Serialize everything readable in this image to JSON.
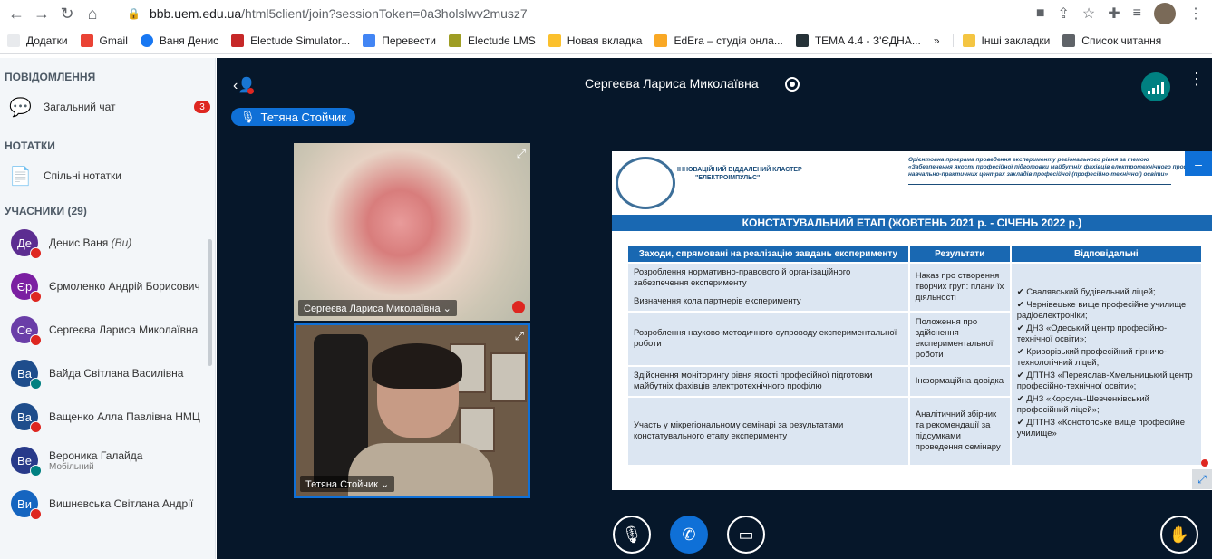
{
  "browser": {
    "url_host": "bbb.uem.edu.ua",
    "url_path": "/html5client/join?sessionToken=0a3holslwv2musz7"
  },
  "bookmarks": [
    {
      "label": "Додатки",
      "color": "#1a73e8"
    },
    {
      "label": "Gmail",
      "color": "#ea4335"
    },
    {
      "label": "Ваня Денис",
      "color": "#1877f2"
    },
    {
      "label": "Electude Simulator...",
      "color": "#c62828"
    },
    {
      "label": "Перевести",
      "color": "#4285f4"
    },
    {
      "label": "Electude LMS",
      "color": "#9e9d24"
    },
    {
      "label": "Новая вкладка",
      "color": "#fbc02d"
    },
    {
      "label": "EdEra – студія онла...",
      "color": "#f9a825"
    },
    {
      "label": "ТЕМА 4.4 - З'ЄДНА...",
      "color": "#263238"
    }
  ],
  "bookmarks_more": "»",
  "bookmarks_other": "Інші закладки",
  "bookmarks_reading": "Список читання",
  "sidebar": {
    "messages_title": "ПОВІДОМЛЕННЯ",
    "public_chat": "Загальний чат",
    "public_chat_badge": "3",
    "notes_title": "НОТАТКИ",
    "shared_notes": "Спільні нотатки",
    "users_title": "УЧАСНИКИ (29)",
    "users": [
      {
        "initials": "Де",
        "name": "Денис Ваня",
        "suffix": "(Ви)",
        "color": "#5c2d91",
        "status": "mic-off"
      },
      {
        "initials": "Єр",
        "name": "Єрмоленко Андрій Борисович",
        "suffix": "",
        "color": "#7b1fa2",
        "status": "mic-off"
      },
      {
        "initials": "Се",
        "name": "Сергеєва Лариса Миколаївна",
        "suffix": "",
        "color": "#6a3ea8",
        "status": "mic-off"
      },
      {
        "initials": "Ва",
        "name": "Вайда Світлана Василівна",
        "suffix": "",
        "color": "#1e4d8c",
        "status": "headset"
      },
      {
        "initials": "Ва",
        "name": "Ващенко Алла Павлівна НМЦ",
        "suffix": "",
        "color": "#1e4d8c",
        "status": "mic-off"
      },
      {
        "initials": "Ве",
        "name": "Вероника Галайда",
        "suffix": "",
        "sub": "Мобільний",
        "color": "#283a8a",
        "status": "headset"
      },
      {
        "initials": "Ви",
        "name": "Вишневська Світлана Андрії",
        "suffix": "",
        "color": "#1565c0",
        "status": "mic-off"
      }
    ]
  },
  "main": {
    "presenter": "Сергеєва Лариса Миколаївна",
    "talking": "Тетяна Стойчик",
    "video1_label": "Сергеєва Лариса Миколаївна ⌄",
    "video2_label": "Тетяна Стойчик ⌄"
  },
  "slide": {
    "cluster": "ІННОВАЦІЙНИЙ ВІДДАЛЕНИЙ КЛАСТЕР",
    "cluster2": "\"ЕЛЕКТРОІМПУЛЬС\"",
    "program1": "Орієнтовна програма проведення експерименту регіонального рівня за темою",
    "program2": "«Забезпечення якості професійної підготовки майбутніх фахівців електротехнічного профілю",
    "program3": "навчально-практичних центрах закладів професійної (професійно-технічної) освіти»",
    "band": "КОНСТАТУВАЛЬНИЙ ЕТАП (ЖОВТЕНЬ 2021  р. - СІЧЕНЬ 2022 р.)",
    "col1": "Заходи, спрямовані на реалізацію завдань експерименту",
    "col2": "Результати",
    "col3": "Відповідальні",
    "r1a": "Розроблення нормативно-правового й організаційного забезпечення експерименту",
    "r1b": "Визначення кола партнерів експерименту",
    "r1res": "Наказ про створення творчих груп: плани їх діяльності",
    "r2": "Розроблення науково-методичного супроводу експериментальної роботи",
    "r2res": "Положення про здійснення експериментальної роботи",
    "r3": "Здійснення моніторингу рівня якості професійної підготовки майбутніх фахівців електротехнічного профілю",
    "r3res": "Інформаційна довідка",
    "r4": "Участь у мікрегіональному семінарі за результатами констатувального етапу експерименту",
    "r4res": "Аналітичний збірник та рекомендації за підсумками проведення семінару",
    "responsible": [
      "✔ Свалявський будівельний ліцей;",
      "✔ Чернівецьке вище професійне училище радіоелектроніки;",
      "✔ ДНЗ «Одеський центр професійно-технічної освіти»;",
      "✔ Криворізький професійний гірничо-технологічний ліцей;",
      "✔ ДПТНЗ «Переяслав-Хмельницький центр професійно-технічної освіти»;",
      "✔ ДНЗ «Корсунь-Шевченківський професійний ліцей»;",
      "✔ ДПТНЗ «Конотопське вище професійне училище»"
    ]
  }
}
